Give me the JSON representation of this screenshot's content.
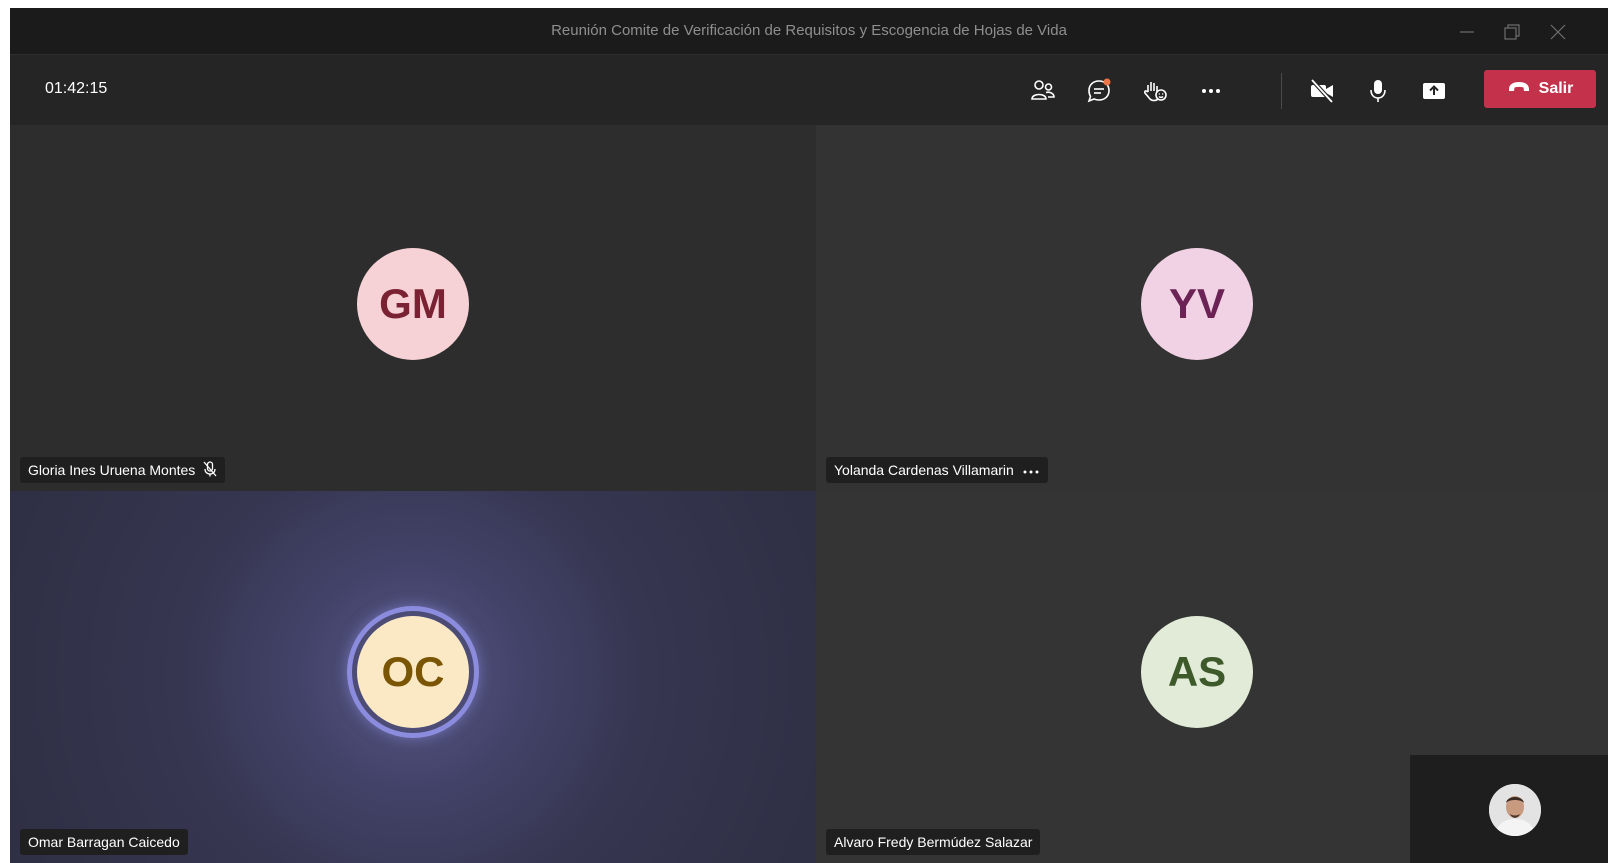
{
  "window": {
    "title": "Reunión Comite de Verificación de Requisitos y Escogencia de Hojas de Vida"
  },
  "toolbar": {
    "timer": "01:42:15",
    "icons": [
      "participants-icon",
      "chat-icon",
      "raise-hand-icon",
      "more-options-icon",
      "camera-off-icon",
      "microphone-icon",
      "share-screen-icon"
    ],
    "leave_label": "Salir",
    "leave_color": "#c4314b",
    "chat_notification": true
  },
  "participants": [
    {
      "initials": "GM",
      "name": "Gloria Ines Uruena Montes",
      "avatar_bg": "#f6d1d5",
      "avatar_fg": "#7a2233",
      "status": "muted"
    },
    {
      "initials": "YV",
      "name": "Yolanda Cardenas Villamarin",
      "avatar_bg": "#f1d2e4",
      "avatar_fg": "#6b2356",
      "status": "more-options"
    },
    {
      "initials": "OC",
      "name": "Omar Barragan Caicedo",
      "avatar_bg": "#fbe9c6",
      "avatar_fg": "#7a5504",
      "status": "speaking"
    },
    {
      "initials": "AS",
      "name": "Alvaro Fredy Bermúdez Salazar",
      "avatar_bg": "#e1ebd8",
      "avatar_fg": "#3e5a2a",
      "status": "none"
    }
  ],
  "accent_color": "#8b8cde"
}
